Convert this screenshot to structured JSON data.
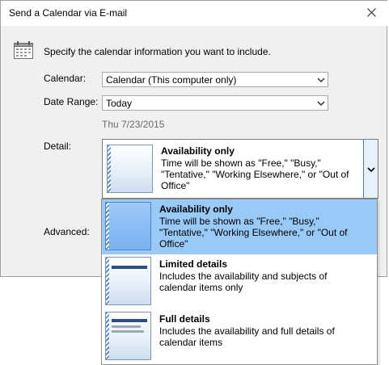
{
  "window": {
    "title": "Send a Calendar via E-mail"
  },
  "intro": "Specify the calendar information you want to include.",
  "calendar": {
    "label": "Calendar:",
    "value": "Calendar (This computer only)"
  },
  "date_range": {
    "label": "Date Range:",
    "value": "Today",
    "date": "Thu 7/23/2015"
  },
  "detail": {
    "label": "Detail:",
    "selected_title": "Availability only",
    "selected_desc": "Time will be shown as \"Free,\" \"Busy,\" \"Tentative,\" \"Working Elsewhere,\" or \"Out of Office\""
  },
  "advanced": {
    "label": "Advanced:"
  },
  "options": [
    {
      "title": "Availability only",
      "desc": "Time will be shown as \"Free,\" \"Busy,\" \"Tentative,\" \"Working Elsewhere,\" or \"Out of Office\""
    },
    {
      "title": "Limited details",
      "desc": "Includes the availability and subjects of calendar items only"
    },
    {
      "title": "Full details",
      "desc": "Includes the availability and full details of calendar items"
    }
  ],
  "colors": {
    "highlight": "#99c9f7",
    "dialog_bg": "#f0f0f0"
  }
}
